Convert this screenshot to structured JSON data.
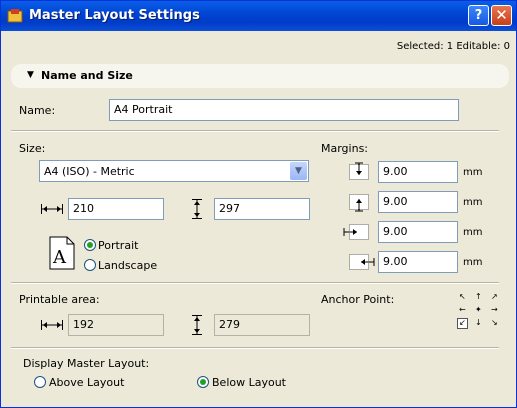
{
  "window": {
    "title": "Master Layout Settings",
    "help_label": "?",
    "close_label": "✕"
  },
  "selection_info": "Selected: 1 Editable: 0",
  "panel": {
    "title": "Name and Size"
  },
  "name": {
    "label": "Name:",
    "value": "A4 Portrait"
  },
  "size": {
    "label": "Size:",
    "selected": "A4 (ISO) - Metric",
    "width": "210",
    "height": "297"
  },
  "orientation": {
    "glyph": "A",
    "portrait_label": "Portrait",
    "landscape_label": "Landscape",
    "selected": "Portrait"
  },
  "margins": {
    "label": "Margins:",
    "values": [
      "9.00",
      "9.00",
      "9.00",
      "9.00"
    ],
    "unit": "mm"
  },
  "printable": {
    "label": "Printable area:",
    "width": "192",
    "height": "279"
  },
  "anchor": {
    "label": "Anchor Point:"
  },
  "display": {
    "label": "Display Master Layout:",
    "above_label": "Above Layout",
    "below_label": "Below Layout",
    "selected": "Below Layout"
  },
  "icons": {
    "app": "archicad-app-icon",
    "width": "width-arrows-icon",
    "height": "height-arrows-icon"
  }
}
